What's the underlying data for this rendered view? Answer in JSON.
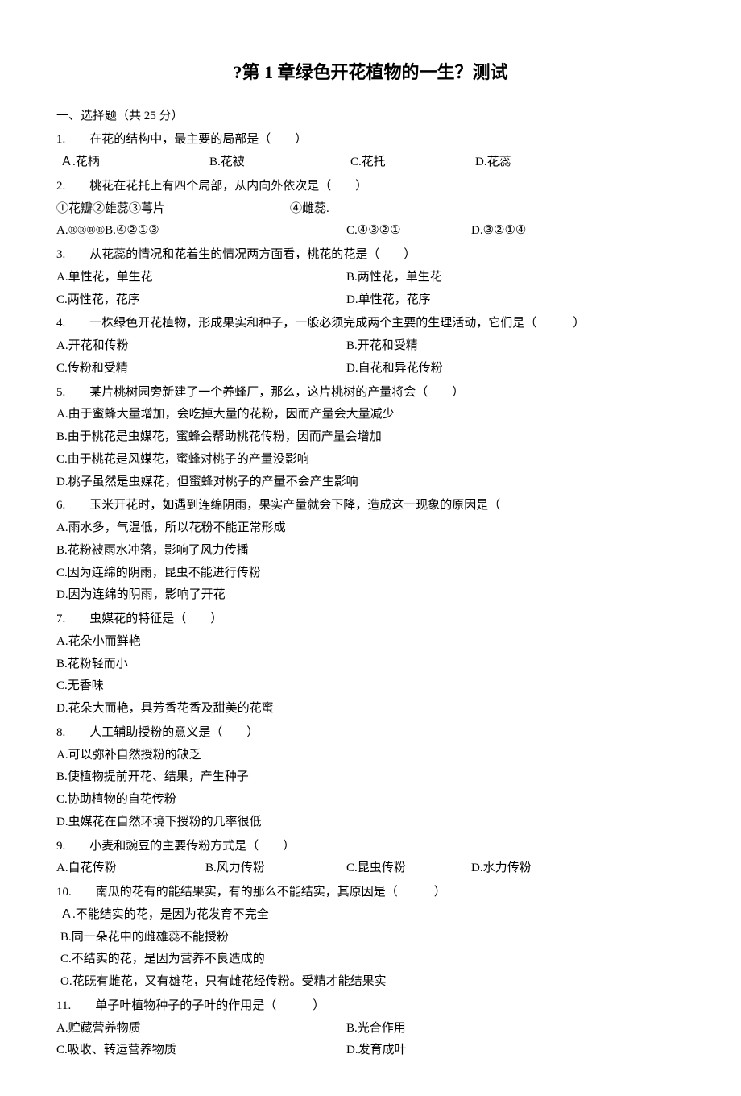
{
  "title": "?第 1 章绿色开花植物的一生？测试",
  "section_header": "一、选择题（共 25 分）",
  "q1": {
    "num": "1.",
    "stem": "在花的结构中，最主要的局部是（　　）",
    "opts": [
      "Ａ.花柄",
      "B.花被",
      "C.花托",
      "D.花蕊"
    ]
  },
  "q2": {
    "num": "2.",
    "stem": "桃花在花托上有四个局部，从内向外依次是（　　）",
    "circles_a": "①花瓣②雄蕊③萼片",
    "circles_b": "④雌蕊.",
    "opts": [
      "A.®®®®B.④②①③",
      "C.④③②①",
      "D.③②①④"
    ]
  },
  "q3": {
    "num": "3.",
    "stem": "从花蕊的情况和花着生的情况两方面看，桃花的花是（　　）",
    "opts": [
      "A.单性花，单生花",
      "B.两性花，单生花",
      "C.两性花，花序",
      "D.单性花，花序"
    ]
  },
  "q4": {
    "num": "4.",
    "stem": "一株绿色开花植物，形成果实和种子，一般必须完成两个主要的生理活动，它们是（　　　）",
    "opts": [
      "A.开花和传粉",
      "B.开花和受精",
      "C.传粉和受精",
      "D.自花和异花传粉"
    ]
  },
  "q5": {
    "num": "5.",
    "stem": "某片桃树园旁新建了一个养蜂厂，那么，这片桃树的产量将会（　　）",
    "opts": [
      "A.由于蜜蜂大量增加，会吃掉大量的花粉，因而产量会大量减少",
      "B.由于桃花是虫媒花，蜜蜂会帮助桃花传粉，因而产量会增加",
      "C.由于桃花是风媒花，蜜蜂对桃子的产量没影响",
      "D.桃子虽然是虫媒花，但蜜蜂对桃子的产量不会产生影响"
    ]
  },
  "q6": {
    "num": "6.",
    "stem": "玉米开花时，如遇到连绵阴雨，果实产量就会下降，造成这一现象的原因是（",
    "opts": [
      "A.雨水多，气温低，所以花粉不能正常形成",
      "B.花粉被雨水冲落，影响了风力传播",
      "C.因为连绵的阴雨，昆虫不能进行传粉",
      "D.因为连绵的阴雨，影响了开花"
    ]
  },
  "q7": {
    "num": "7.",
    "stem": "虫媒花的特征是（　　）",
    "opts": [
      "A.花朵小而鲜艳",
      "B.花粉轻而小",
      "C.无香味",
      "D.花朵大而艳，具芳香花香及甜美的花蜜"
    ]
  },
  "q8": {
    "num": "8.",
    "stem": "人工辅助授粉的意义是（　　）",
    "opts": [
      "A.可以弥补自然授粉的缺乏",
      "B.使植物提前开花、结果，产生种子",
      "C.协助植物的自花传粉",
      "D.虫媒花在自然环境下授粉的几率很低"
    ]
  },
  "q9": {
    "num": "9.",
    "stem": "小麦和豌豆的主要传粉方式是（　　）",
    "opts": [
      "A.自花传粉",
      "B.风力传粉",
      "C.昆虫传粉",
      "D.水力传粉"
    ]
  },
  "q10": {
    "num": "10.",
    "stem": "南瓜的花有的能结果实，有的那么不能结实，其原因是（　　　）",
    "opts": [
      "Ａ.不能结实的花，是因为花发育不完全",
      "B.同一朵花中的雌雄蕊不能授粉",
      "C.不结实的花，是因为营养不良造成的",
      "O.花既有雌花，又有雄花，只有雌花经传粉。受精才能结果实"
    ]
  },
  "q11": {
    "num": "11.",
    "stem": "单子叶植物种子的子叶的作用是（　　　）",
    "opts": [
      "A.贮藏营养物质",
      "B.光合作用",
      "C.吸收、转运营养物质",
      "D.发育成叶"
    ]
  }
}
